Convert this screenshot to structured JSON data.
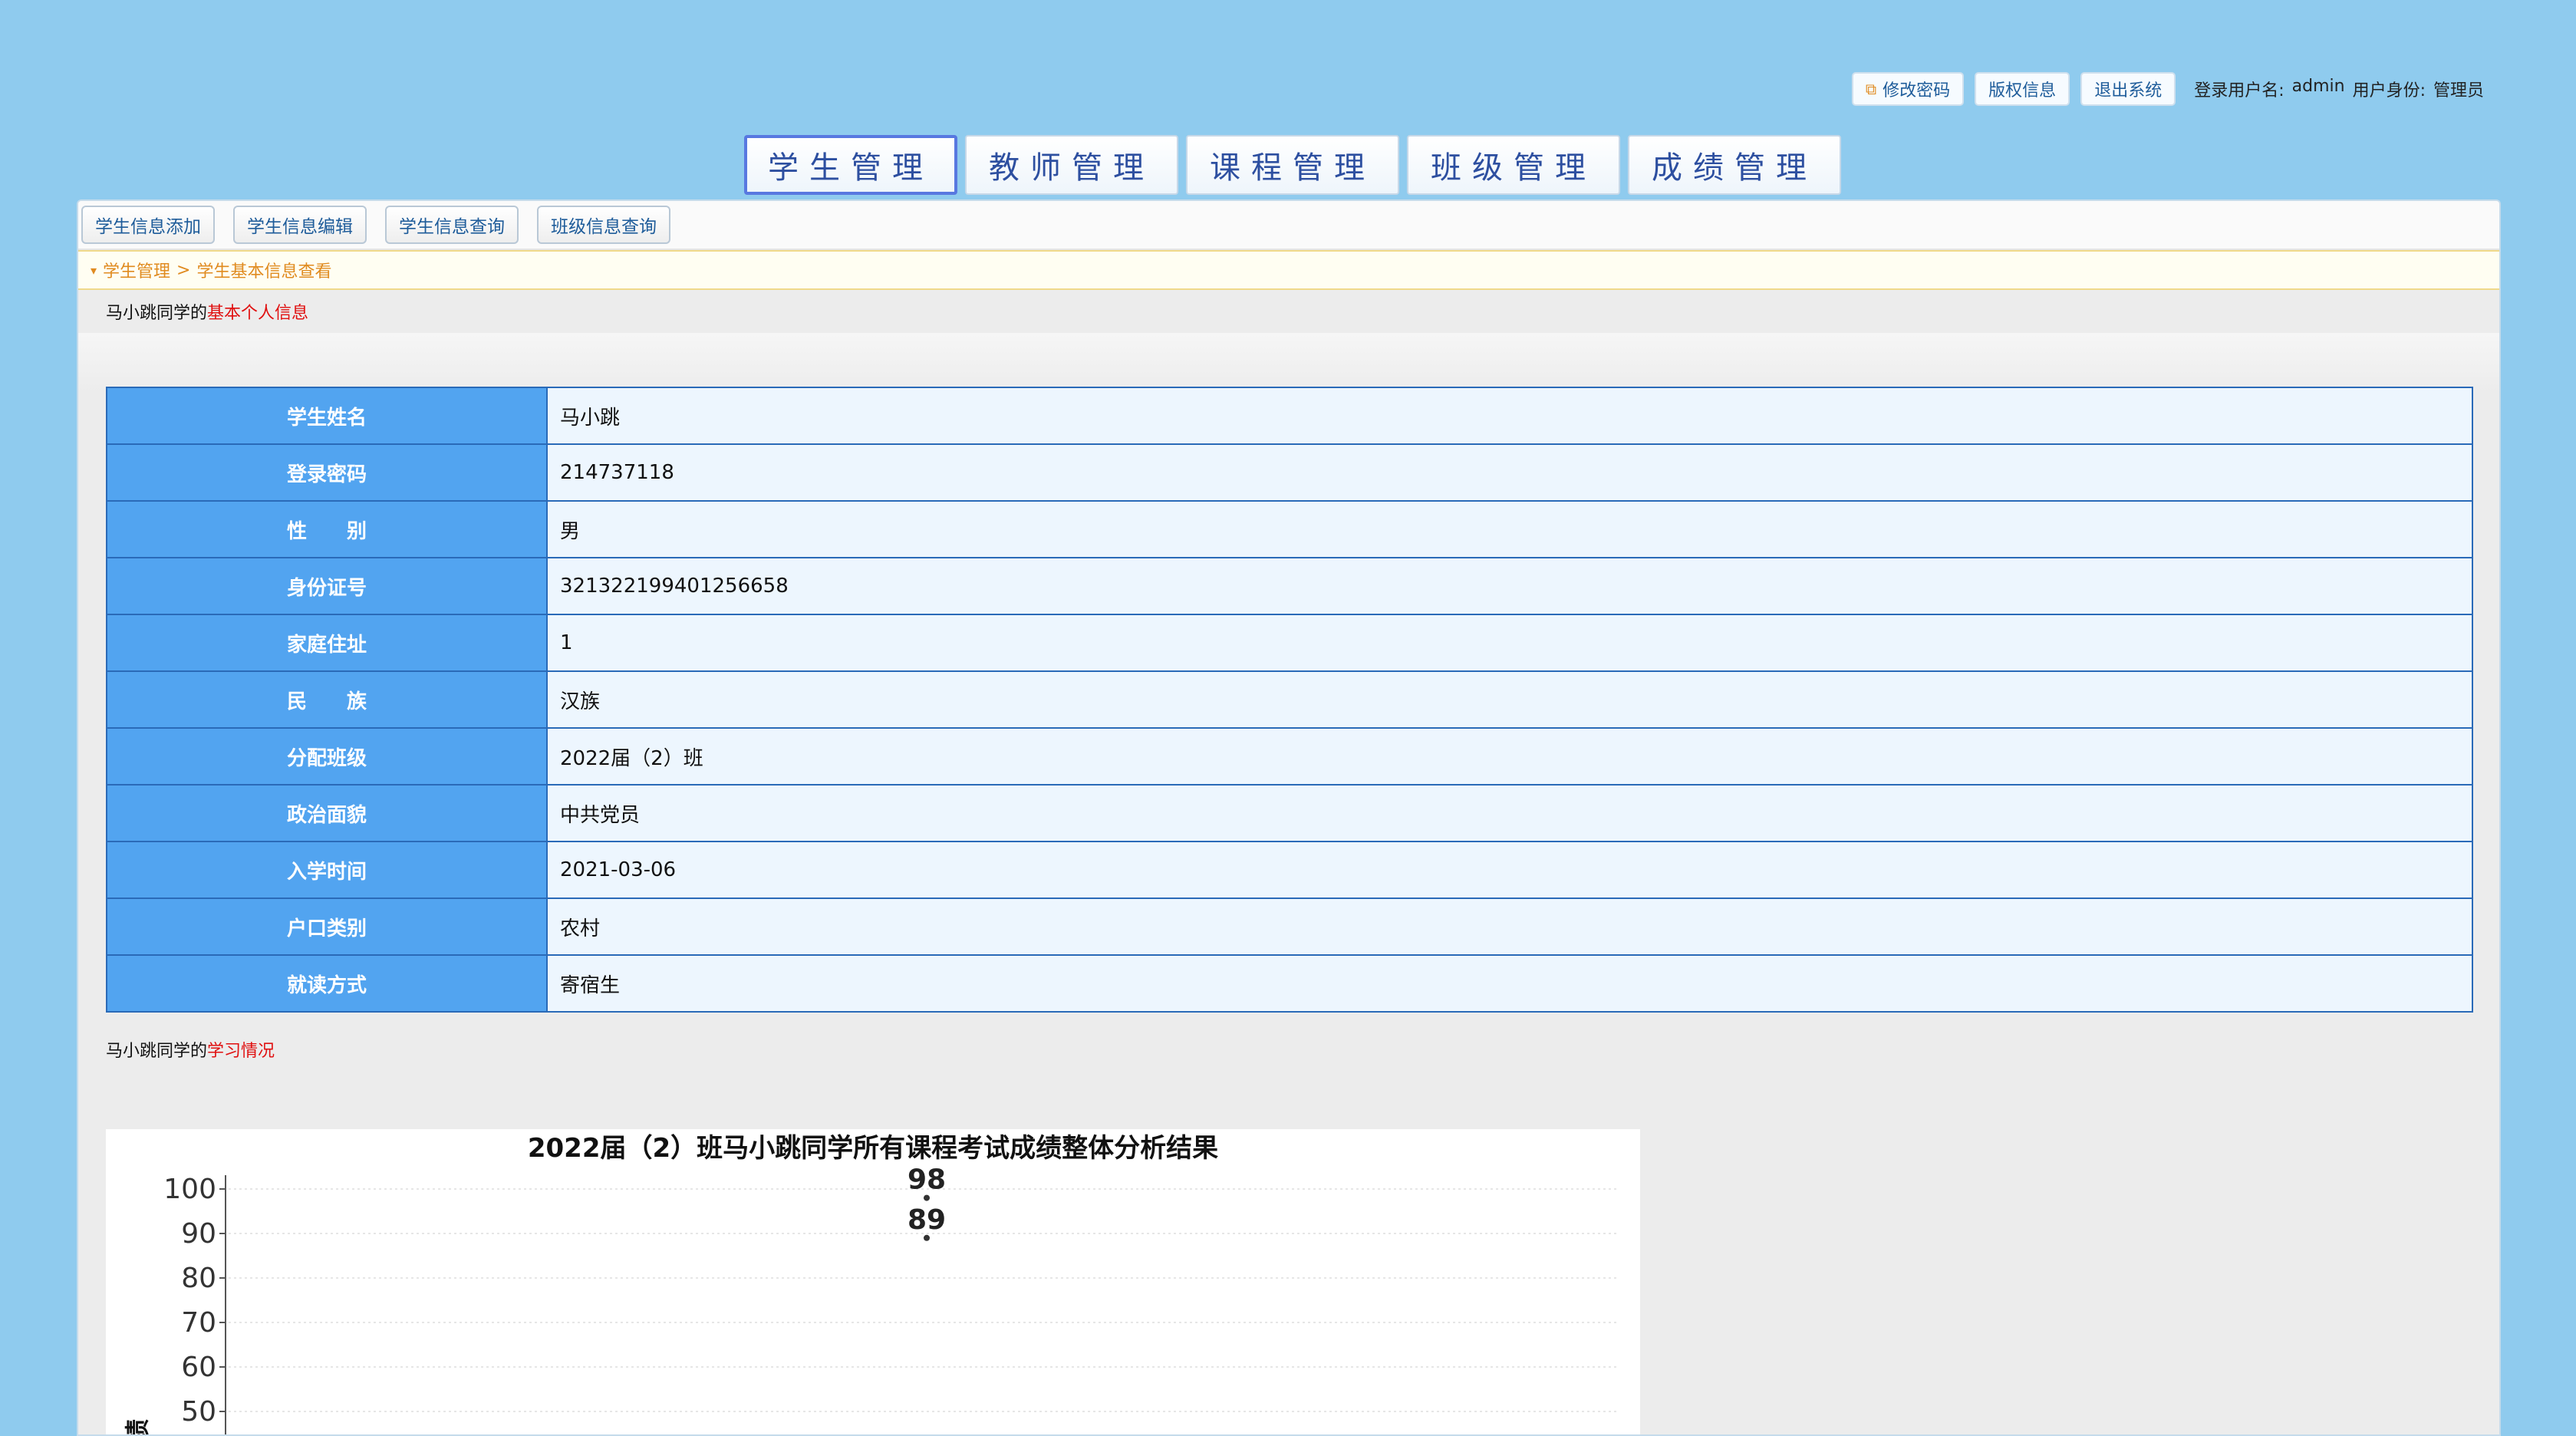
{
  "top_bar": {
    "buttons": [
      {
        "label": "修改密码",
        "icon": "external-link-icon"
      },
      {
        "label": "版权信息"
      },
      {
        "label": "退出系统"
      }
    ],
    "login_label": "登录用户名:",
    "login_user": "admin",
    "role_label": "用户身份:",
    "role": "管理员"
  },
  "main_tabs": [
    {
      "label": "学生管理",
      "active": true
    },
    {
      "label": "教师管理"
    },
    {
      "label": "课程管理"
    },
    {
      "label": "班级管理"
    },
    {
      "label": "成绩管理"
    }
  ],
  "sub_nav": [
    "学生信息添加",
    "学生信息编辑",
    "学生信息查询",
    "班级信息查询"
  ],
  "breadcrumb": {
    "root": "学生管理",
    "separator": ">",
    "current": "学生基本信息查看"
  },
  "section1": {
    "prefix": "马小跳同学的",
    "highlight": "基本个人信息"
  },
  "student_info": [
    {
      "label": "学生姓名",
      "value": "马小跳"
    },
    {
      "label": "登录密码",
      "value": "214737118"
    },
    {
      "label": "性　　别",
      "value": "男"
    },
    {
      "label": "身份证号",
      "value": "321322199401256658"
    },
    {
      "label": "家庭住址",
      "value": "1"
    },
    {
      "label": "民　　族",
      "value": "汉族"
    },
    {
      "label": "分配班级",
      "value": "2022届（2）班"
    },
    {
      "label": "政治面貌",
      "value": "中共党员"
    },
    {
      "label": "入学时间",
      "value": "2021-03-06"
    },
    {
      "label": "户口类别",
      "value": "农村"
    },
    {
      "label": "就读方式",
      "value": "寄宿生"
    }
  ],
  "section2": {
    "prefix": "马小跳同学的",
    "highlight": "学习情况"
  },
  "colors": {
    "accent_red": "#e01010",
    "label_blue": "#52a4f0",
    "border_blue": "#2a6ab8",
    "bg": "#8fcbee",
    "breadcrumb_orange": "#e08b20"
  },
  "chart_data": {
    "type": "scatter",
    "title": "2022届（2）班马小跳同学所有课程考试成绩整体分析结果",
    "ylabel": "成绩",
    "xlabel": "",
    "yticks": [
      100,
      90,
      80,
      70,
      60,
      50
    ],
    "ylim": [
      45,
      100
    ],
    "grid": true,
    "points": [
      {
        "value": 98,
        "label": "98"
      },
      {
        "value": 89,
        "label": "89"
      }
    ]
  }
}
